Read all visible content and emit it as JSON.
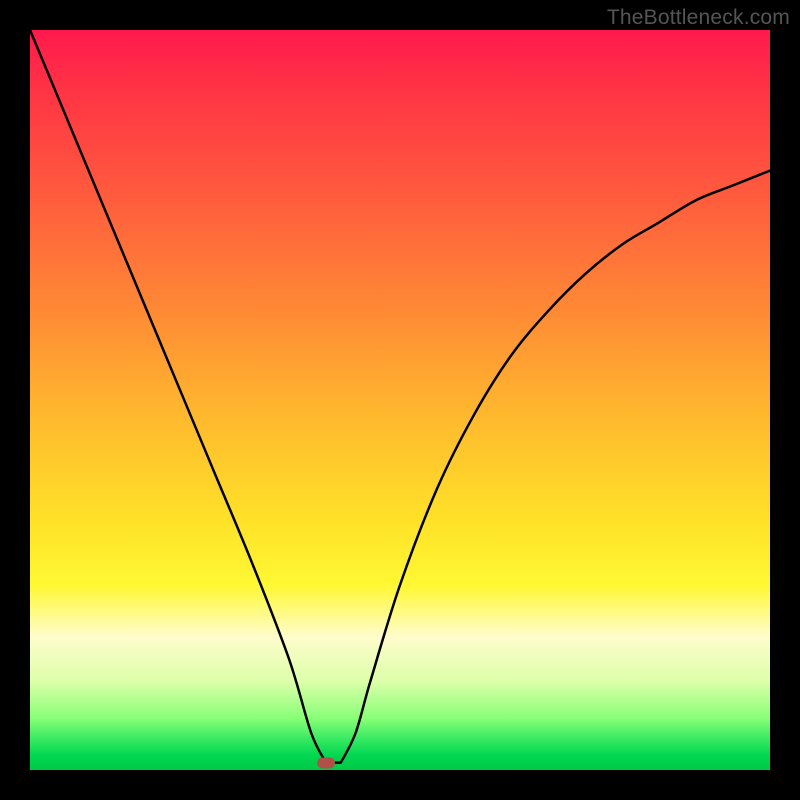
{
  "watermark": "TheBottleneck.com",
  "chart_data": {
    "type": "line",
    "title": "",
    "xlabel": "",
    "ylabel": "",
    "xlim": [
      0,
      100
    ],
    "ylim": [
      0,
      100
    ],
    "grid": false,
    "legend": false,
    "background_gradient": {
      "top": "#ff1a4d",
      "bottom": "#00c848",
      "stops": [
        "red",
        "orange",
        "yellow",
        "pale-yellow",
        "light-green",
        "green"
      ]
    },
    "series": [
      {
        "name": "bottleneck-curve",
        "color": "#000000",
        "x": [
          0,
          5,
          10,
          15,
          20,
          25,
          30,
          35,
          38,
          40,
          42,
          44,
          46,
          50,
          55,
          60,
          65,
          70,
          75,
          80,
          85,
          90,
          95,
          100
        ],
        "values": [
          100,
          88,
          76,
          64,
          52,
          40,
          28,
          15,
          5,
          1,
          1,
          5,
          12,
          25,
          38,
          48,
          56,
          62,
          67,
          71,
          74,
          77,
          79,
          81
        ]
      }
    ],
    "marker": {
      "name": "optimal-point",
      "x": 40,
      "y": 1,
      "color": "#b05048"
    }
  }
}
